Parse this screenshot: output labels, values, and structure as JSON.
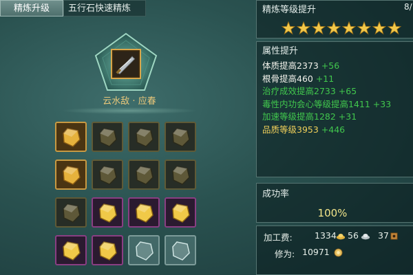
{
  "tabs": {
    "refine_upgrade": "精炼升级",
    "quick_refine": "五行石快速精炼"
  },
  "item": {
    "name": "云水敌 · 应春"
  },
  "refine_level": {
    "title": "精炼等级提升",
    "page_indicator": "8/",
    "stars_count": 8
  },
  "attributes": {
    "title": "属性提升",
    "rows": [
      {
        "label": "体质提高2373",
        "bonus": "+56",
        "label_color": "#f1f1ea"
      },
      {
        "label": "根骨提高460",
        "bonus": "+11",
        "label_color": "#f1f1ea"
      },
      {
        "label": "治疗成效提高2733",
        "bonus": "+65",
        "label_color": "#41c74d"
      },
      {
        "label": "毒性内功会心等级提高1411",
        "bonus": "+33",
        "label_color": "#41c74d"
      },
      {
        "label": "加速等级提高1282",
        "bonus": "+31",
        "label_color": "#41c74d"
      },
      {
        "label": "品质等级3953",
        "bonus": "+446",
        "label_color": "#f0d05a"
      }
    ]
  },
  "success_rate": {
    "title": "成功率",
    "value": "100%"
  },
  "cost": {
    "label": "加工费:",
    "gold": "1334",
    "silver": "56",
    "copper": "37",
    "cultivation_label": "修为:",
    "cultivation_value": "10971"
  },
  "colors": {
    "accent_gold": "#e9c77a",
    "bonus_green": "#41c74d",
    "rate_yellow": "#f2e58a",
    "gold_slot": "#c99a42",
    "purple_slot": "#8a3e83"
  },
  "slots": [
    {
      "state": "gold",
      "icon": "gem-icon"
    },
    {
      "state": "dim",
      "icon": "gem-icon"
    },
    {
      "state": "dim",
      "icon": "gem-icon"
    },
    {
      "state": "dim",
      "icon": "gem-icon"
    },
    {
      "state": "gold",
      "icon": "gem-icon"
    },
    {
      "state": "dim",
      "icon": "gem-icon"
    },
    {
      "state": "dim",
      "icon": "gem-icon"
    },
    {
      "state": "dim",
      "icon": "gem-icon"
    },
    {
      "state": "dim",
      "icon": "gem-icon"
    },
    {
      "state": "purple",
      "icon": "gem-icon"
    },
    {
      "state": "purple",
      "icon": "gem-icon"
    },
    {
      "state": "purple",
      "icon": "gem-icon"
    },
    {
      "state": "purple",
      "icon": "gem-icon"
    },
    {
      "state": "purple",
      "icon": "gem-icon"
    },
    {
      "state": "empty",
      "icon": "gem-outline-icon"
    },
    {
      "state": "empty",
      "icon": "gem-outline-icon"
    }
  ]
}
